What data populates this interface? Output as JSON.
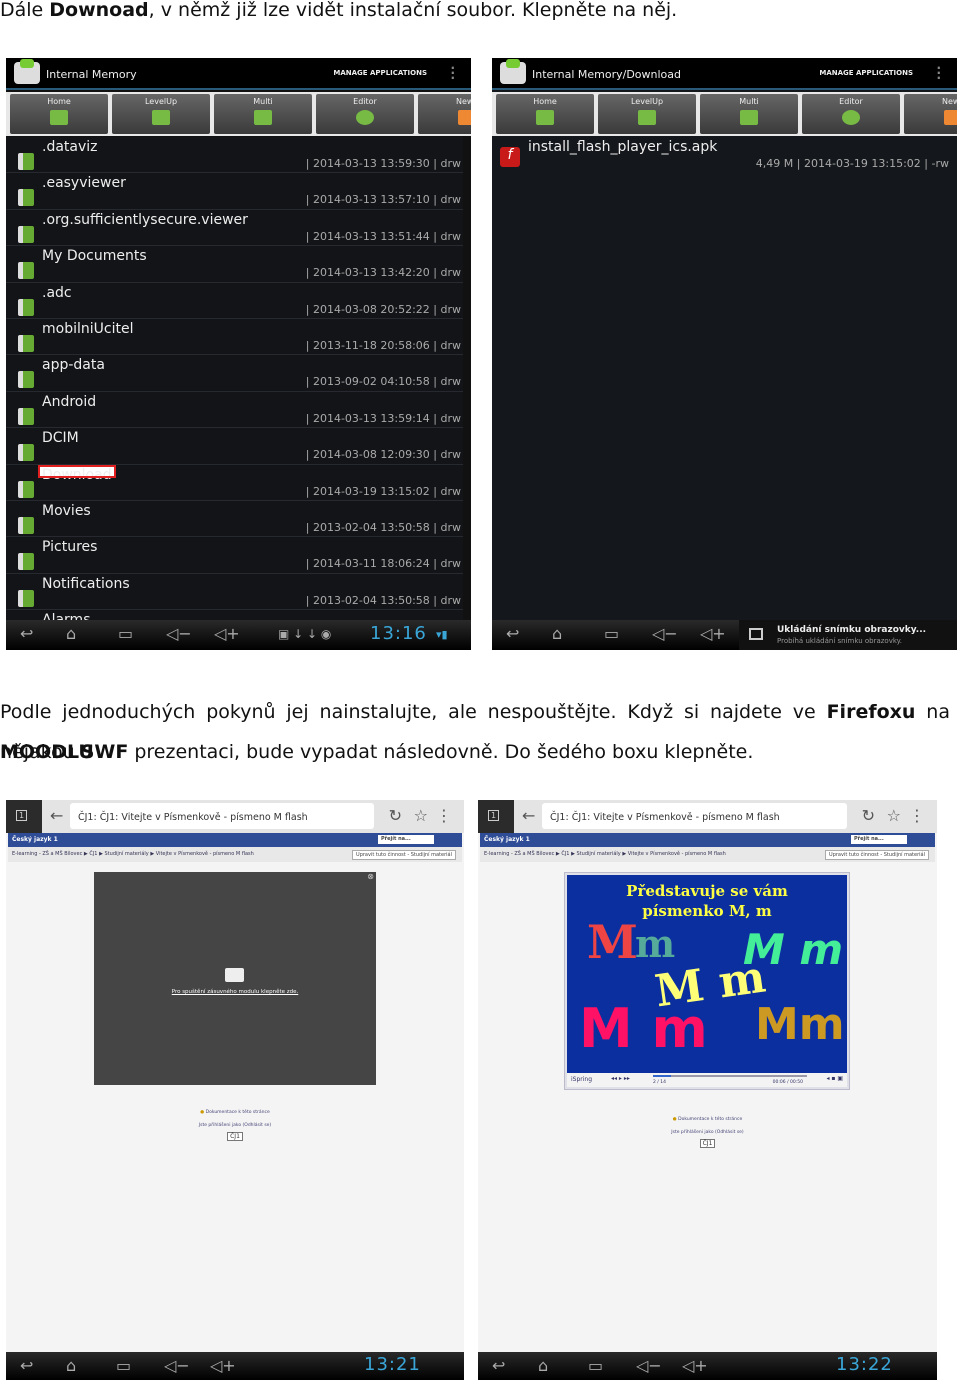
{
  "intro": {
    "pre": "Dále ",
    "bold": "Downoad",
    "post": ", v němž již lze vidět instalační soubor. Klepněte na něj."
  },
  "para2": {
    "t1": "Podle jednoduchých pokynů jej nainstalujte, ale nespouštějte. Když si najdete ve ",
    "b1": "Firefoxu",
    "t2": " na ",
    "b2": "MOODLU",
    "t3": "nějakou ",
    "b3": "SWF",
    "t4": " prezentaci, bude vypadat následovně. Do šedého boxu klepněte."
  },
  "fm_left": {
    "title": "Internal Memory",
    "manage": "MANAGE APPLICATIONS",
    "toolbar": [
      "Home",
      "LevelUp",
      "Multi",
      "Editor",
      "NewF"
    ],
    "rows": [
      {
        "name": ".dataviz",
        "meta": "| 2014-03-13 13:59:30 | drw"
      },
      {
        "name": ".easyviewer",
        "meta": "| 2014-03-13 13:57:10 | drw"
      },
      {
        "name": ".org.sufficientlysecure.viewer",
        "meta": "| 2014-03-13 13:51:44 | drw"
      },
      {
        "name": "My Documents",
        "meta": "| 2014-03-13 13:42:20 | drw"
      },
      {
        "name": ".adc",
        "meta": "| 2014-03-08 20:52:22 | drw"
      },
      {
        "name": "mobilniUcitel",
        "meta": "| 2013-11-18 20:58:06 | drw"
      },
      {
        "name": "app-data",
        "meta": "| 2013-09-02 04:10:58 | drw"
      },
      {
        "name": "Android",
        "meta": "| 2014-03-13 13:59:14 | drw"
      },
      {
        "name": "DCIM",
        "meta": "| 2014-03-08 12:09:30 | drw"
      },
      {
        "name": "Download",
        "meta": "| 2014-03-19 13:15:02 | drw",
        "highlighted": true
      },
      {
        "name": "Movies",
        "meta": "| 2013-02-04 13:50:58 | drw"
      },
      {
        "name": "Pictures",
        "meta": "| 2014-03-11 18:06:24 | drw"
      },
      {
        "name": "Notifications",
        "meta": "| 2013-02-04 13:50:58 | drw"
      },
      {
        "name": "Alarms",
        "meta": ""
      }
    ],
    "clock": "13:16"
  },
  "fm_right": {
    "title": "Internal Memory/Download",
    "manage": "MANAGE APPLICATIONS",
    "toolbar": [
      "Home",
      "LevelUp",
      "Multi",
      "Editor",
      "NewF"
    ],
    "file": {
      "name": "install_flash_player_ics.apk",
      "meta": "4,49 M | 2014-03-19 13:15:02 | -rw"
    },
    "notif_title": "Ukládání snímku obrazovky...",
    "notif_sub": "Probíhá ukládání snímku obrazovky."
  },
  "web": {
    "tab_count": "1",
    "url_title": "ČJ1: ČJ1: Vitejte v Písmenkově - písmeno M flash",
    "course": "Český jazyk 1",
    "jump": "Přejít na...",
    "breadcrumb": "E-learning - ZŠ a MŠ Bílovec ▶ ČJ1 ▶ Studijní materiály ▶ Vitejte v Písmenkově - písmeno M flash",
    "edit_btn": "Upravit tuto činnost - Studijní materiál",
    "plugin_msg": "Pro spuštění zásuvného modulu klepněte zde.",
    "doc_link": "Dokumentace k této stránce",
    "login_info": "Jste přihlášeni jako (Odhlásit se)",
    "cj_btn": "ČJ1",
    "clock_left": "13:21",
    "clock_right": "13:22",
    "slide_title": "Představuje se vám písmenko M, m",
    "player_brand": "iSpring",
    "slide_counter": "2 / 14",
    "time": "00:06 / 00:50"
  },
  "colors": {
    "accent": "#3aa6d8",
    "highlight": "#e02020",
    "moodle_blue": "#2f4d97",
    "slide_bg": "#0b2f9e"
  }
}
